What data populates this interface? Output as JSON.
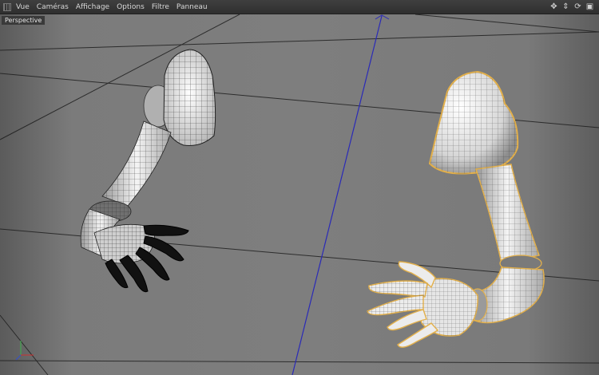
{
  "menubar": {
    "items": [
      "Vue",
      "Caméras",
      "Affichage",
      "Options",
      "Filtre",
      "Panneau"
    ]
  },
  "viewport": {
    "label": "Perspective"
  },
  "colors": {
    "selection_outline": "#e3b04b",
    "axis_line": "#2a2ab8",
    "mesh_dark": "#111111"
  },
  "icons": [
    "menu-grip-icon",
    "move-view-icon",
    "zoom-view-icon",
    "rotate-view-icon",
    "maximize-view-icon"
  ]
}
